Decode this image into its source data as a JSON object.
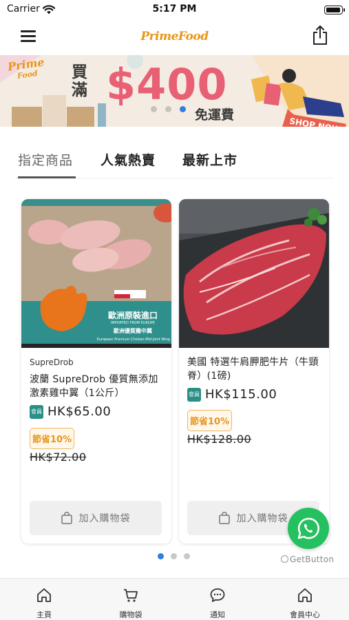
{
  "status_bar": {
    "carrier": "Carrier",
    "time": "5:17 PM"
  },
  "nav": {
    "brand": "PrimeFood"
  },
  "banner": {
    "logo_top": "Prime",
    "logo_bottom": "Food",
    "spend_text": "買滿",
    "amount": "$400",
    "shipping_text": "免運費",
    "shop_now": "SHOP NOW",
    "slide_count": 3,
    "active_slide": 3
  },
  "tabs": [
    {
      "label": "指定商品"
    },
    {
      "label": "人氣熱賣"
    },
    {
      "label": "最新上市"
    }
  ],
  "products": [
    {
      "brand": "SupreDrob",
      "title": "波蘭 SupreDrob 優質無添加激素雞中翼（1公斤）",
      "member_badge": "會員",
      "price": "HK$65.00",
      "discount": "節省10%",
      "original_price": "HK$72.00",
      "button_label": "加入購物袋",
      "image_text_1": "歐洲原裝進口",
      "image_text_2": "IMPORTED FROM EUROPE",
      "image_text_3": "歐洲優質雞中翼",
      "image_text_4": "European Premium Chicken Mid Joint Wing"
    },
    {
      "brand": "",
      "title": "美國 特選牛肩胛肥牛片（牛頸脊）(1磅)",
      "member_badge": "會員",
      "price": "HK$115.00",
      "discount": "節省10%",
      "original_price": "HK$128.00",
      "button_label": "加入購物袋"
    }
  ],
  "pagination": {
    "count": 3,
    "active": 1
  },
  "floating": {
    "getbutton": "GetButton"
  },
  "bottom_nav": [
    {
      "label": "主頁",
      "icon": "home-icon"
    },
    {
      "label": "購物袋",
      "icon": "cart-icon"
    },
    {
      "label": "通知",
      "icon": "chat-bubble-icon"
    },
    {
      "label": "會員中心",
      "icon": "home-icon"
    }
  ],
  "colors": {
    "brand_orange": "#e8961a",
    "banner_pink": "#e86074",
    "active_blue": "#2f7de2",
    "whatsapp_green": "#25c05f",
    "member_teal": "#2a8f85"
  }
}
